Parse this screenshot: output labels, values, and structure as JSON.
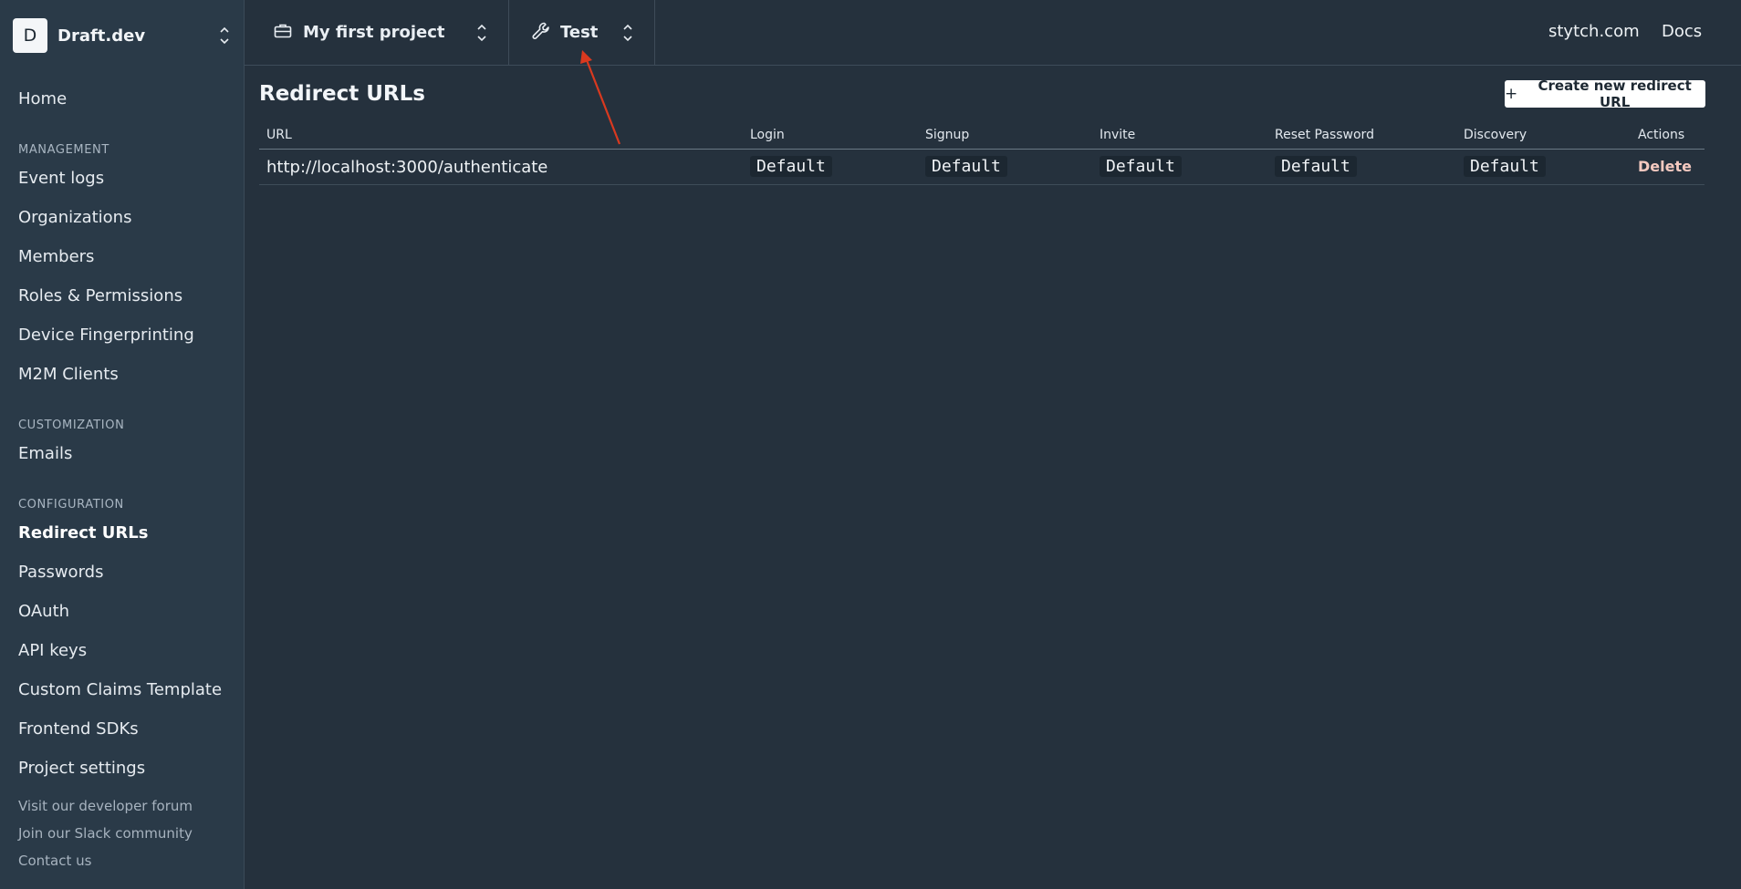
{
  "org": {
    "initial": "D",
    "name": "Draft.dev"
  },
  "sidebar": {
    "home": "Home",
    "sections": [
      {
        "title": "MANAGEMENT",
        "items": [
          "Event logs",
          "Organizations",
          "Members",
          "Roles & Permissions",
          "Device Fingerprinting",
          "M2M Clients"
        ]
      },
      {
        "title": "CUSTOMIZATION",
        "items": [
          "Emails"
        ]
      },
      {
        "title": "CONFIGURATION",
        "items": [
          "Redirect URLs",
          "Passwords",
          "OAuth",
          "API keys",
          "Custom Claims Template",
          "Frontend SDKs",
          "Project settings"
        ]
      }
    ],
    "active": "Redirect URLs",
    "footer_links": [
      "Visit our developer forum",
      "Join our Slack community",
      "Contact us"
    ]
  },
  "topbar": {
    "project": "My first project",
    "environment": "Test",
    "links": [
      "stytch.com",
      "Docs"
    ]
  },
  "page": {
    "title": "Redirect URLs",
    "create_button": "Create new redirect URL"
  },
  "table": {
    "columns": [
      "URL",
      "Login",
      "Signup",
      "Invite",
      "Reset Password",
      "Discovery",
      "Actions"
    ],
    "rows": [
      {
        "url": "http://localhost:3000/authenticate",
        "login": "Default",
        "signup": "Default",
        "invite": "Default",
        "reset_password": "Default",
        "discovery": "Default",
        "action": "Delete"
      }
    ]
  },
  "annotation": {
    "arrow_color": "#d9391f"
  },
  "icons": {
    "project": "briefcase-icon",
    "environment": "wrench-icon",
    "create": "plus-icon",
    "selector": "chevron-up-down-icon"
  }
}
